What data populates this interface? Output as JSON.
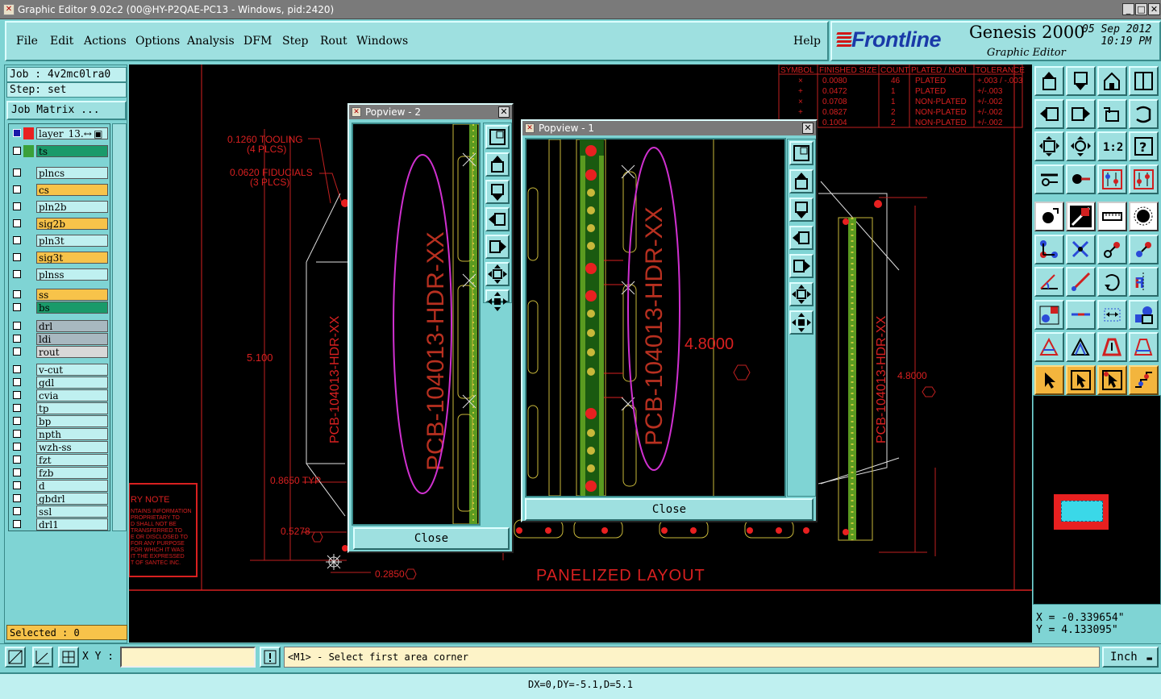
{
  "window": {
    "title": "Graphic Editor 9.02c2 (00@HY-P2QAE-PC13 - Windows, pid:2420)"
  },
  "menubar": {
    "items": [
      "File",
      "Edit",
      "Actions",
      "Options",
      "Analysis",
      "DFM",
      "Step",
      "Rout",
      "Windows"
    ],
    "help": "Help"
  },
  "brand": {
    "logo": "Frontline",
    "product": "Genesis 2000",
    "subtitle": "Graphic Editor",
    "date": "05 Sep 2012",
    "time": "10:19 PM"
  },
  "job": {
    "job_line": "Job : 4v2mc0lra0",
    "step_line": "Step: set",
    "matrix_button": "Job Matrix ..."
  },
  "layers": [
    {
      "name": "layer_13.↔ ▣",
      "color": "#e82020",
      "bg": "#bff0f0",
      "first": true
    },
    {
      "name": "ts",
      "color": "#3aa03a",
      "bg": "#1a9a6a"
    },
    {
      "name": "plncs",
      "color": "",
      "bg": "#bff0f0"
    },
    {
      "name": "cs",
      "color": "",
      "bg": "#f7c34a"
    },
    {
      "name": "pln2b",
      "color": "",
      "bg": "#bff0f0"
    },
    {
      "name": "sig2b",
      "color": "",
      "bg": "#f7c34a"
    },
    {
      "name": "pln3t",
      "color": "",
      "bg": "#bff0f0"
    },
    {
      "name": "sig3t",
      "color": "",
      "bg": "#f7c34a"
    },
    {
      "name": "plnss",
      "color": "",
      "bg": "#bff0f0"
    },
    {
      "name": "ss",
      "color": "",
      "bg": "#f7c34a"
    },
    {
      "name": "bs",
      "color": "",
      "bg": "#1a9a6a"
    },
    {
      "name": "drl",
      "color": "",
      "bg": "#a8b8c0"
    },
    {
      "name": "ldi",
      "color": "",
      "bg": "#a8b8c0"
    },
    {
      "name": "rout",
      "color": "",
      "bg": "#d8d8d8"
    },
    {
      "name": "v-cut",
      "color": "",
      "bg": "#bff0f0"
    },
    {
      "name": "gdl",
      "color": "",
      "bg": "#bff0f0"
    },
    {
      "name": "cvia",
      "color": "",
      "bg": "#bff0f0"
    },
    {
      "name": "tp",
      "color": "",
      "bg": "#bff0f0"
    },
    {
      "name": "bp",
      "color": "",
      "bg": "#bff0f0"
    },
    {
      "name": "npth",
      "color": "",
      "bg": "#bff0f0"
    },
    {
      "name": "wzh-ss",
      "color": "",
      "bg": "#bff0f0"
    },
    {
      "name": "fzt",
      "color": "",
      "bg": "#bff0f0"
    },
    {
      "name": "fzb",
      "color": "",
      "bg": "#bff0f0"
    },
    {
      "name": "d",
      "color": "",
      "bg": "#bff0f0"
    },
    {
      "name": "gbdrl",
      "color": "",
      "bg": "#bff0f0"
    },
    {
      "name": "ssl",
      "color": "",
      "bg": "#bff0f0"
    },
    {
      "name": "drl1",
      "color": "",
      "bg": "#bff0f0"
    }
  ],
  "selected": "Selected : 0",
  "drawing": {
    "tooling": "0.1260 TOOLING",
    "tooling_count": "(4 PLCS)",
    "fiducials": "0.0620 FIDUCIALS",
    "fiducials_count": "(3 PLCS)",
    "dim_5100": "5.100",
    "dim_8650": "0.8650 TYP",
    "dim_5278": "0.5278",
    "dim_2850": "0.2850",
    "dim_4800": "4.8000",
    "board_text": "PCB-104013-HDR-XX",
    "panel_title": "PANELIZED LAYOUT",
    "note_title": "RY NOTE",
    "note_lines": [
      "NTAINS INFORMATION",
      "PROPRIETARY TO",
      "D SHALL NOT BE",
      "TRANSFERRED TO",
      "E OR DISCLOSED TO",
      "FOR ANY PURPOSE",
      "FOR WHICH IT WAS",
      "IT THE EXPRESSED",
      "T OF SANTEC INC."
    ],
    "drill_table": {
      "headers": [
        "SYMBOL",
        "FINISHED SIZE",
        "COUNT",
        "PLATED / NON",
        "TOLERANCE"
      ],
      "rows": [
        [
          "×",
          "0.0080",
          "46",
          "PLATED",
          "+.003 / -.003"
        ],
        [
          "+",
          "0.0472",
          "1",
          "PLATED",
          "+/-.003"
        ],
        [
          "×",
          "0.0708",
          "1",
          "NON-PLATED",
          "+/-.002"
        ],
        [
          "+",
          "0.0827",
          "2",
          "NON-PLATED",
          "+/-.002"
        ],
        [
          "×",
          "0.1004",
          "2",
          "NON-PLATED",
          "+/-.002"
        ]
      ]
    }
  },
  "popview2": {
    "title": "Popview - 2",
    "close": "Close",
    "board_text": "PCB-104013-HDR-XX"
  },
  "popview1": {
    "title": "Popview - 1",
    "close": "Close",
    "board_text": "PCB-104013-HDR-XX",
    "dim": "4.8000"
  },
  "coords": {
    "x": "X = -0.339654\"",
    "y": "Y = 4.133095\""
  },
  "bottom": {
    "xy_label": "X Y :",
    "xy_value": "",
    "prompt": "<M1> - Select first area corner",
    "unit": "Inch"
  },
  "status": "DX=0,DY=-5.1,D=5.1",
  "colors": {
    "canvas": "#000000",
    "panel": "#7fd4d4",
    "accent_red": "#e82020",
    "highlight_orange": "#f3b53d",
    "magenta": "#d030d0"
  }
}
